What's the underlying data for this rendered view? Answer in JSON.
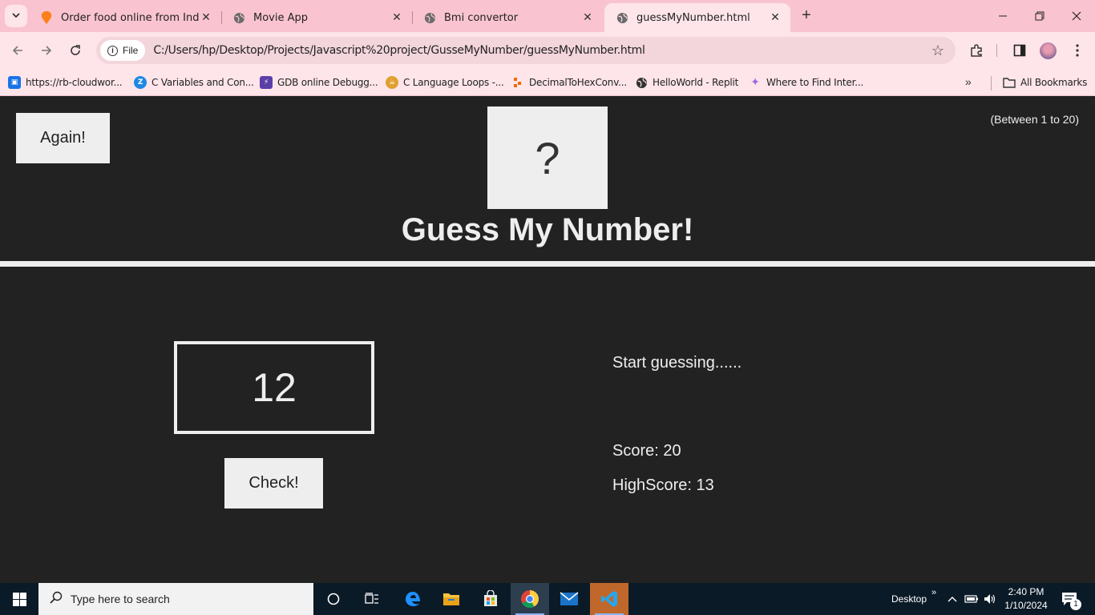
{
  "browser": {
    "tabs": [
      {
        "title": "Order food online from India's",
        "active": false
      },
      {
        "title": "Movie App",
        "active": false
      },
      {
        "title": "Bmi convertor",
        "active": false
      },
      {
        "title": "guessMyNumber.html",
        "active": true
      }
    ],
    "address": {
      "scheme_label": "File",
      "url": "C:/Users/hp/Desktop/Projects/Javascript%20project/GusseMyNumber/guessMyNumber.html"
    },
    "bookmarks": [
      {
        "label": "https://rb-cloudwor...",
        "icon": "briefcase-icon",
        "color": "#1a73e8"
      },
      {
        "label": "C Variables and Con...",
        "icon": "z-logo-icon",
        "color": "#1e88e5"
      },
      {
        "label": "GDB online Debugg...",
        "icon": "bolt-icon",
        "color": "#5b3ea6"
      },
      {
        "label": "C Language Loops -...",
        "icon": "cup-icon",
        "color": "#e0a030"
      },
      {
        "label": "DecimalToHexConv...",
        "icon": "squares-icon",
        "color": "#ef6c00"
      },
      {
        "label": "HelloWorld - Replit",
        "icon": "globe-icon",
        "color": "#333333"
      },
      {
        "label": "Where to Find Inter...",
        "icon": "sparkle-icon",
        "color": "#9c6ade"
      }
    ],
    "all_bookmarks_label": "All Bookmarks"
  },
  "game": {
    "again_label": "Again!",
    "range_label": "(Between 1 to 20)",
    "secret_display": "?",
    "title": "Guess My Number!",
    "guess_value": "12",
    "check_label": "Check!",
    "message": "Start guessing......",
    "score_text": "Score: 20",
    "highscore_text": "HighScore: 13"
  },
  "taskbar": {
    "search_placeholder": "Type here to search",
    "desktop_label": "Desktop",
    "time": "2:40 PM",
    "date": "1/10/2024",
    "notification_count": "1"
  },
  "colors": {
    "tabstrip": "#f9c4d0",
    "toolbar": "#fde5ea",
    "page_bg": "#222222",
    "page_fg": "#eeeeee",
    "taskbar": "#0b1a27"
  }
}
